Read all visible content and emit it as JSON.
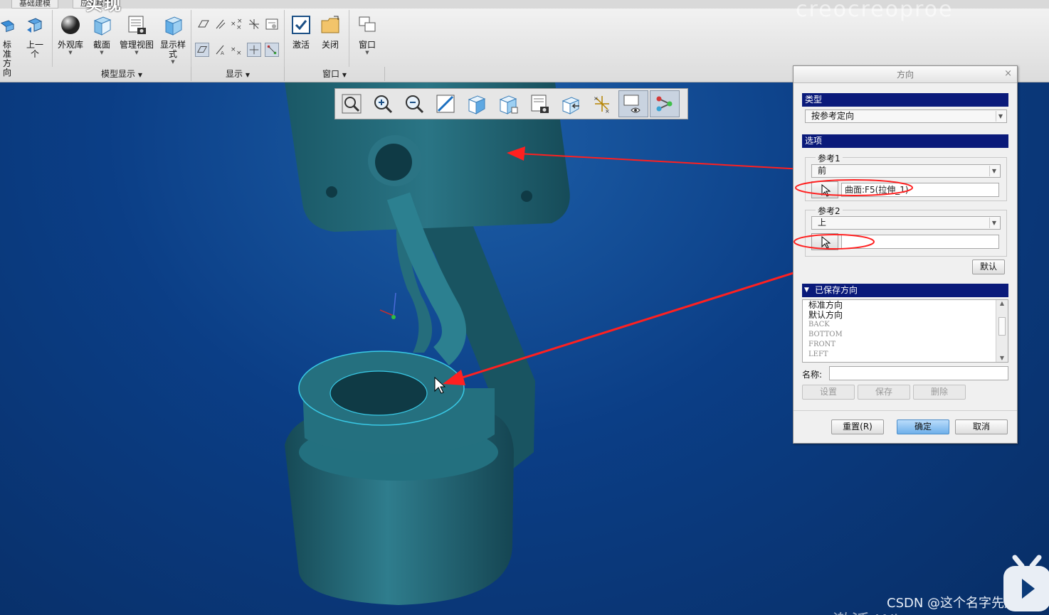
{
  "overlay_caption": "实现",
  "watermark_top": "creocreoproe",
  "ribbon": {
    "tabs": [
      "基础建模",
      "应用程序"
    ],
    "left_buttons": [
      {
        "label": "标准方向"
      },
      {
        "label": "上一个"
      }
    ],
    "model_display_buttons": [
      {
        "label": "外观库"
      },
      {
        "label": "截面"
      },
      {
        "label": "管理视图"
      },
      {
        "label": "显示样式"
      }
    ],
    "window_buttons": [
      {
        "label": "激活"
      },
      {
        "label": "关闭"
      },
      {
        "label": "窗口"
      }
    ],
    "groups": {
      "model_display": "模型显示",
      "display": "显示",
      "window": "窗口"
    }
  },
  "dialog": {
    "title": "方向",
    "close": "×",
    "type_section": "类型",
    "type_value": "按参考定向",
    "options_section": "选项",
    "ref1_label": "参考1",
    "ref1_value": "前",
    "ref1_surface": "曲面:F5(拉伸_1)",
    "ref2_label": "参考2",
    "ref2_value": "上",
    "ref2_surface": "",
    "default_button": "默认",
    "saved_section": "已保存方向",
    "saved_items": [
      "标准方向",
      "默认方向",
      "BACK",
      "BOTTOM",
      "FRONT",
      "LEFT"
    ],
    "name_label": "名称:",
    "name_value": "",
    "set_button": "设置",
    "save_button": "保存",
    "delete_button": "删除",
    "reset_button": "重置(R)",
    "ok_button": "确定",
    "cancel_button": "取消"
  },
  "watermarks": {
    "csdn": "CSDN @这个名字先用着",
    "windows": "激活 Wi"
  },
  "colors": {
    "model": "#1f6575",
    "highlight": "#39c9e6",
    "annotation": "#ff2020",
    "dialog_header": "#0a1a7a",
    "primary_button": "#6fb0ea"
  }
}
